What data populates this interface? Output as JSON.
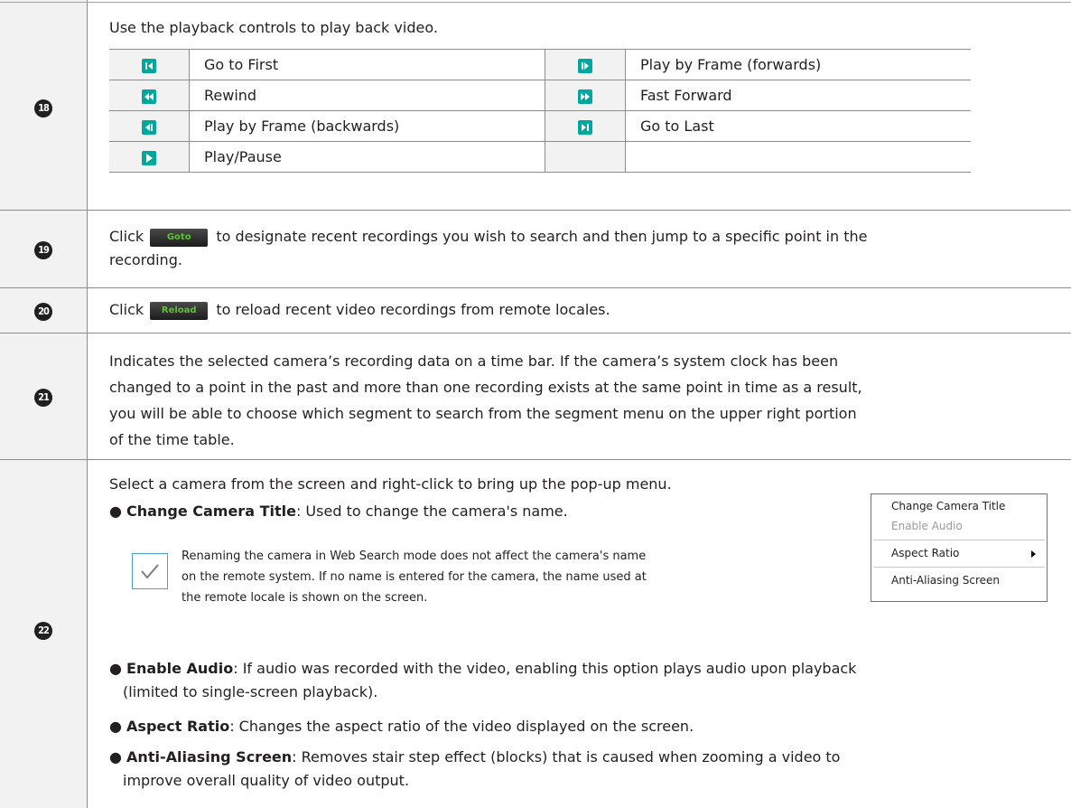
{
  "rows": [
    {
      "num": "18"
    },
    {
      "num": "19"
    },
    {
      "num": "20"
    },
    {
      "num": "21"
    },
    {
      "num": "22"
    }
  ],
  "playback": {
    "intro": "Use the playback controls to play back video.",
    "controls": [
      {
        "left_icon": "go-to-first-icon",
        "left": "Go to First",
        "right_icon": "play-frame-forward-icon",
        "right": "Play by Frame (forwards)"
      },
      {
        "left_icon": "rewind-icon",
        "left": "Rewind",
        "right_icon": "fast-forward-icon",
        "right": "Fast Forward"
      },
      {
        "left_icon": "play-frame-backward-icon",
        "left": "Play by Frame (backwards)",
        "right_icon": "go-to-last-icon",
        "right": "Go to Last"
      },
      {
        "left_icon": "play-pause-icon",
        "left": "Play/Pause",
        "right_icon": "",
        "right": ""
      }
    ]
  },
  "goto": {
    "click": "Click",
    "button": "Goto",
    "rest_line1": "to designate recent recordings you wish to search and then jump to a specific point in the",
    "rest_line2": "recording."
  },
  "reload": {
    "click": "Click",
    "button": "Reload",
    "rest": "to reload recent video recordings from remote locales."
  },
  "timebar": {
    "lines": [
      "Indicates the selected camera’s recording data on a time bar. If the camera’s system clock has been",
      "changed to a point in the past and more than one recording exists at the same point in time as a result,",
      "you will be able to choose which segment to search from the segment menu on the upper right portion",
      "of the time table."
    ]
  },
  "popup_section": {
    "intro": "Select a camera from the screen and right-click to bring up the pop-up menu.",
    "change_title_term": "Change Camera Title",
    "change_title_desc": ": Used to change the camera's name.",
    "note_lines": [
      "Renaming the camera in Web Search mode does not affect the camera's name",
      "on the remote system. If no name is entered for the camera, the name used at",
      "the remote locale is shown on the screen."
    ],
    "enable_audio_term": "Enable Audio",
    "enable_audio_desc_1": ": If audio was recorded with the video, enabling this option plays audio upon playback",
    "enable_audio_desc_2": "(limited to single-screen playback).",
    "aspect_term": "Aspect Ratio",
    "aspect_desc": ": Changes the aspect ratio of the video displayed on the screen.",
    "anti_term": "Anti-Aliasing Screen",
    "anti_desc_1": ": Removes stair step effect (blocks) that is caused when zooming a video to",
    "anti_desc_2": "improve overall quality of video output.",
    "menu": {
      "item1": "Change Camera Title",
      "item2": "Enable Audio",
      "item3": "Aspect Ratio",
      "item4": "Anti-Aliasing Screen"
    }
  },
  "colors": {
    "accent": "#00a79d",
    "note": "#4a9fd0"
  }
}
